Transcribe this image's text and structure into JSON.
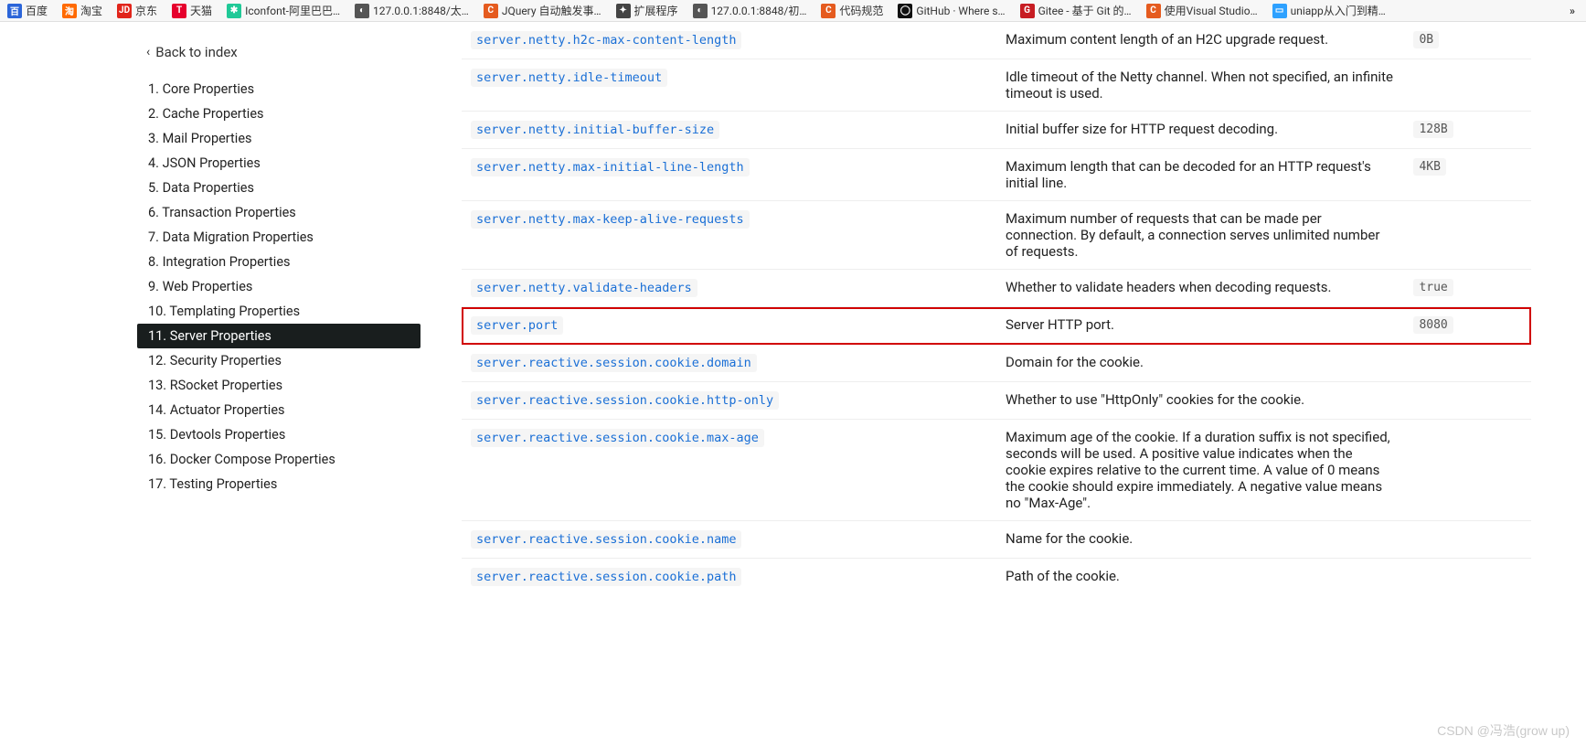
{
  "bookmarks": [
    {
      "label": "百度",
      "color": "#2b65d9"
    },
    {
      "label": "淘宝",
      "color": "#ff6a00"
    },
    {
      "label": "京东",
      "color": "#e1251b",
      "icon": "JD"
    },
    {
      "label": "天猫",
      "color": "#e6002d",
      "icon": "T"
    },
    {
      "label": "Iconfont-阿里巴巴…",
      "color": "#20c997",
      "icon": "✱"
    },
    {
      "label": "127.0.0.1:8848/太…",
      "color": "#555",
      "icon": "◐"
    },
    {
      "label": "JQuery 自动触发事…",
      "color": "#e55b1f",
      "icon": "C"
    },
    {
      "label": "扩展程序",
      "color": "#444",
      "icon": "✦"
    },
    {
      "label": "127.0.0.1:8848/初…",
      "color": "#555",
      "icon": "◐"
    },
    {
      "label": "代码规范",
      "color": "#e55b1f",
      "icon": "C"
    },
    {
      "label": "GitHub · Where s…",
      "color": "#111",
      "icon": "◯"
    },
    {
      "label": "Gitee - 基于 Git 的…",
      "color": "#c71d23",
      "icon": "G"
    },
    {
      "label": "使用Visual Studio…",
      "color": "#e55b1f",
      "icon": "C"
    },
    {
      "label": "uniapp从入门到精…",
      "color": "#2ea1ff",
      "icon": "▭"
    }
  ],
  "overflow": "»",
  "back_label": "Back to index",
  "toc": [
    {
      "label": "1. Core Properties"
    },
    {
      "label": "2. Cache Properties"
    },
    {
      "label": "3. Mail Properties"
    },
    {
      "label": "4. JSON Properties"
    },
    {
      "label": "5. Data Properties"
    },
    {
      "label": "6. Transaction Properties"
    },
    {
      "label": "7. Data Migration Properties"
    },
    {
      "label": "8. Integration Properties"
    },
    {
      "label": "9. Web Properties"
    },
    {
      "label": "10. Templating Properties"
    },
    {
      "label": "11. Server Properties",
      "active": true
    },
    {
      "label": "12. Security Properties"
    },
    {
      "label": "13. RSocket Properties"
    },
    {
      "label": "14. Actuator Properties"
    },
    {
      "label": "15. Devtools Properties"
    },
    {
      "label": "16. Docker Compose Properties"
    },
    {
      "label": "17. Testing Properties"
    }
  ],
  "rows": [
    {
      "key": "server.netty.h2c-max-content-length",
      "desc": "Maximum content length of an H2C upgrade request.",
      "def": "0B",
      "first": true
    },
    {
      "key": "server.netty.idle-timeout",
      "desc": "Idle timeout of the Netty channel. When not specified, an infinite timeout is used.",
      "def": ""
    },
    {
      "key": "server.netty.initial-buffer-size",
      "desc": "Initial buffer size for HTTP request decoding.",
      "def": "128B"
    },
    {
      "key": "server.netty.max-initial-line-length",
      "desc": "Maximum length that can be decoded for an HTTP request's initial line.",
      "def": "4KB"
    },
    {
      "key": "server.netty.max-keep-alive-requests",
      "desc": "Maximum number of requests that can be made per connection. By default, a connection serves unlimited number of requests.",
      "def": ""
    },
    {
      "key": "server.netty.validate-headers",
      "desc": "Whether to validate headers when decoding requests.",
      "def": "true"
    },
    {
      "key": "server.port",
      "desc": "Server HTTP port.",
      "def": "8080",
      "highlight": true
    },
    {
      "key": "server.reactive.session.cookie.domain",
      "desc": "Domain for the cookie.",
      "def": ""
    },
    {
      "key": "server.reactive.session.cookie.http-only",
      "desc": "Whether to use \"HttpOnly\" cookies for the cookie.",
      "def": ""
    },
    {
      "key": "server.reactive.session.cookie.max-age",
      "desc": "Maximum age of the cookie. If a duration suffix is not specified, seconds will be used. A positive value indicates when the cookie expires relative to the current time. A value of 0 means the cookie should expire immediately. A negative value means no \"Max-Age\".",
      "def": ""
    },
    {
      "key": "server.reactive.session.cookie.name",
      "desc": "Name for the cookie.",
      "def": ""
    },
    {
      "key": "server.reactive.session.cookie.path",
      "desc": "Path of the cookie.",
      "def": ""
    }
  ],
  "watermark": "CSDN @冯浩(grow up)"
}
